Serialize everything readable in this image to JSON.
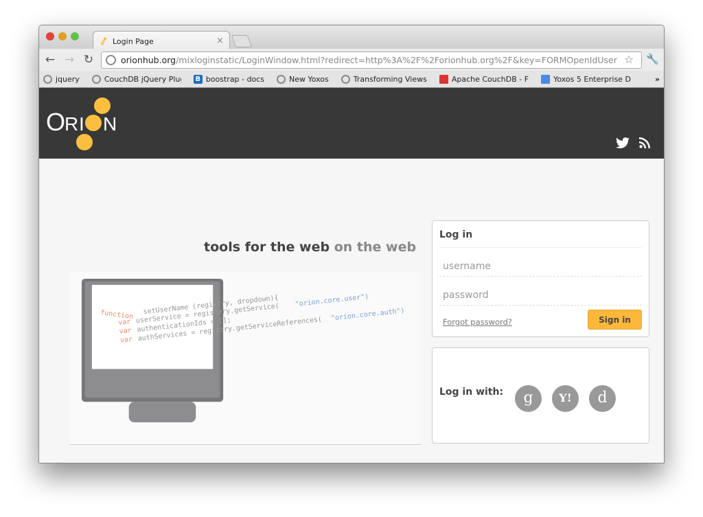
{
  "browser": {
    "tab_title": "Login Page",
    "url_host": "orionhub.org",
    "url_rest": "/mixloginstatic/LoginWindow.html?redirect=http%3A%2F%2Forionhub.org%2F&key=FORMOpenIdUser",
    "bookmarks": [
      {
        "label": "jquery",
        "icon": "globe-icon"
      },
      {
        "label": "CouchDB jQuery Plug",
        "icon": "globe-icon"
      },
      {
        "label": "boostrap - docs",
        "icon": "bootstrap-icon"
      },
      {
        "label": "New Yoxos",
        "icon": "globe-icon"
      },
      {
        "label": "Transforming Views",
        "icon": "globe-icon"
      },
      {
        "label": "Apache CouchDB - F",
        "icon": "couchdb-icon"
      },
      {
        "label": "Yoxos 5 Enterprise D",
        "icon": "document-icon"
      }
    ],
    "more": "»"
  },
  "header": {
    "logo": "ORION",
    "accent": "#fbbf3f"
  },
  "main": {
    "tagline_a": "tools for the web",
    "tagline_b": "on the web",
    "code": {
      "l1a": "function",
      "l1b": "setUserName (registry, dropdown){",
      "l2a": "var",
      "l2b": "userService = registery.getService(",
      "l2c": "\"orion.core.user\")",
      "l3a": "var",
      "l3b": "authenticationIds = [];",
      "l4a": "var",
      "l4b": "authServices = registry.getServiceReferences(",
      "l4c": "\"orion.core.auth\")"
    }
  },
  "login": {
    "title": "Log in",
    "username_placeholder": "username",
    "password_placeholder": "password",
    "forgot": "Forgot password?",
    "signin": "Sign in",
    "login_with": "Log in with:",
    "providers": [
      {
        "name": "google",
        "glyph": "g"
      },
      {
        "name": "yahoo",
        "glyph": "Y!"
      },
      {
        "name": "openid",
        "glyph": "d"
      }
    ]
  }
}
